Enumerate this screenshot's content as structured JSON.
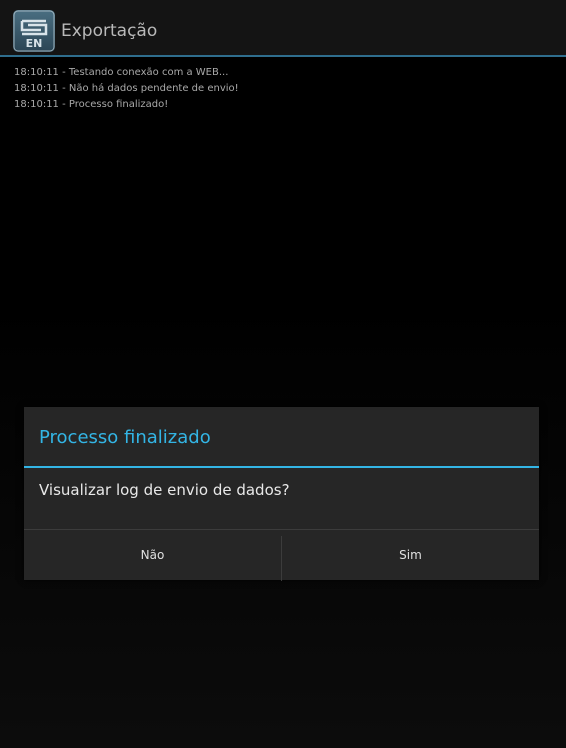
{
  "app": {
    "title": "Exportação",
    "icon": "app-logo-icon",
    "logo_text": "EN",
    "accent_color": "#33b5e5"
  },
  "log": {
    "lines": [
      "18:10:11 - Testando conexão com a WEB...",
      "18:10:11 - Não há dados pendente de envio!",
      "18:10:11 - Processo finalizado!"
    ]
  },
  "dialog": {
    "title": "Processo finalizado",
    "message": "Visualizar log de envio de dados?",
    "buttons": {
      "negative": "Não",
      "positive": "Sim"
    }
  }
}
